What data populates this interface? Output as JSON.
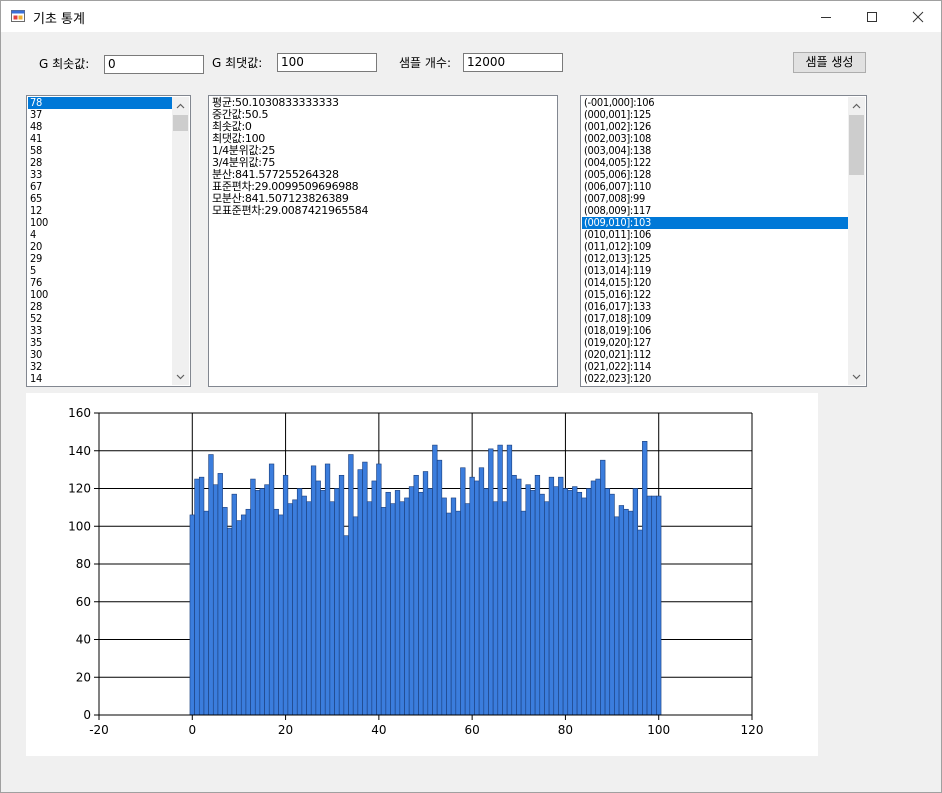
{
  "window": {
    "title": "기초 통계"
  },
  "controls": {
    "min_label": "G 최솟값:",
    "min_value": "0",
    "max_label": "G 최댓값:",
    "max_value": "100",
    "count_label": "샘플 개수:",
    "count_value": "12000",
    "generate_button": "샘플 생성"
  },
  "sample_list": {
    "selected_index": 0,
    "items": [
      "78",
      "37",
      "48",
      "41",
      "58",
      "28",
      "33",
      "67",
      "65",
      "12",
      "100",
      "4",
      "20",
      "29",
      "5",
      "76",
      "100",
      "28",
      "52",
      "33",
      "35",
      "30",
      "32",
      "14"
    ]
  },
  "stats": {
    "lines": [
      "평균:50.1030833333333",
      "중간값:50.5",
      "최솟값:0",
      "최댓값:100",
      "1/4분위값:25",
      "3/4분위값:75",
      "분산:841.577255264328",
      "표준편차:29.0099509696988",
      "모분산:841.507123826389",
      "모표준편차:29.0087421965584"
    ]
  },
  "freq_list": {
    "selected_index": 10,
    "items": [
      "(-001,000]:106",
      "(000,001]:125",
      "(001,002]:126",
      "(002,003]:108",
      "(003,004]:138",
      "(004,005]:122",
      "(005,006]:128",
      "(006,007]:110",
      "(007,008]:99",
      "(008,009]:117",
      "(009,010]:103",
      "(010,011]:106",
      "(011,012]:109",
      "(012,013]:125",
      "(013,014]:119",
      "(014,015]:120",
      "(015,016]:122",
      "(016,017]:133",
      "(017,018]:109",
      "(018,019]:106",
      "(019,020]:127",
      "(020,021]:112",
      "(021,022]:114",
      "(022,023]:120"
    ]
  },
  "chart_data": {
    "type": "bar",
    "title": "",
    "xlabel": "",
    "ylabel": "",
    "xlim": [
      -20,
      120
    ],
    "ylim": [
      0,
      160
    ],
    "xticks": [
      -20,
      0,
      20,
      40,
      60,
      80,
      100,
      120
    ],
    "yticks": [
      0,
      20,
      40,
      60,
      80,
      100,
      120,
      140,
      160
    ],
    "grid": true,
    "bar_color": "#3b7ddd",
    "x": [
      0,
      1,
      2,
      3,
      4,
      5,
      6,
      7,
      8,
      9,
      10,
      11,
      12,
      13,
      14,
      15,
      16,
      17,
      18,
      19,
      20,
      21,
      22,
      23,
      24,
      25,
      26,
      27,
      28,
      29,
      30,
      31,
      32,
      33,
      34,
      35,
      36,
      37,
      38,
      39,
      40,
      41,
      42,
      43,
      44,
      45,
      46,
      47,
      48,
      49,
      50,
      51,
      52,
      53,
      54,
      55,
      56,
      57,
      58,
      59,
      60,
      61,
      62,
      63,
      64,
      65,
      66,
      67,
      68,
      69,
      70,
      71,
      72,
      73,
      74,
      75,
      76,
      77,
      78,
      79,
      80,
      81,
      82,
      83,
      84,
      85,
      86,
      87,
      88,
      89,
      90,
      91,
      92,
      93,
      94,
      95,
      96,
      97,
      98,
      99,
      100
    ],
    "values": [
      106,
      125,
      126,
      108,
      138,
      122,
      128,
      110,
      99,
      117,
      103,
      106,
      109,
      125,
      119,
      120,
      122,
      133,
      109,
      106,
      127,
      112,
      114,
      120,
      116,
      113,
      132,
      124,
      119,
      133,
      113,
      120,
      127,
      95,
      138,
      105,
      130,
      134,
      113,
      124,
      133,
      110,
      118,
      112,
      119,
      113,
      115,
      121,
      127,
      118,
      129,
      120,
      143,
      135,
      115,
      107,
      115,
      108,
      131,
      112,
      126,
      124,
      131,
      120,
      141,
      113,
      143,
      113,
      143,
      127,
      125,
      108,
      122,
      119,
      127,
      117,
      113,
      126,
      121,
      126,
      120,
      119,
      121,
      118,
      115,
      120,
      124,
      125,
      135,
      120,
      117,
      105,
      111,
      109,
      108,
      120,
      98,
      145,
      116,
      116,
      116
    ]
  }
}
